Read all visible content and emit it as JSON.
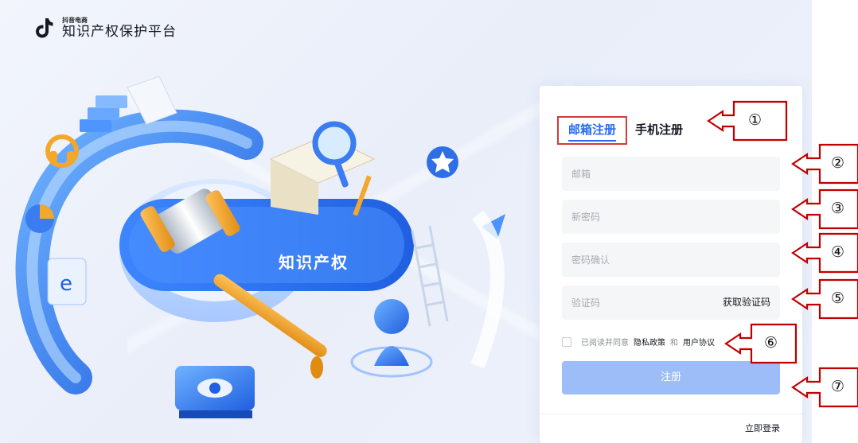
{
  "header": {
    "brand_small": "抖音电商",
    "brand_title": "知识产权保护平台"
  },
  "illustration": {
    "banner_text": "知识产权"
  },
  "form": {
    "tabs": [
      {
        "label": "邮箱注册",
        "active": true
      },
      {
        "label": "手机注册",
        "active": false
      }
    ],
    "email_placeholder": "邮箱",
    "new_password_placeholder": "新密码",
    "confirm_password_placeholder": "密码确认",
    "code_placeholder": "验证码",
    "get_code_label": "获取验证码",
    "agree_prefix": "已阅读并同意",
    "privacy_policy": "隐私政策",
    "and_text": "和",
    "user_agreement": "用户协议",
    "submit_label": "注册",
    "login_link": "立即登录"
  },
  "annotations": [
    "①",
    "②",
    "③",
    "④",
    "⑤",
    "⑥",
    "⑦"
  ],
  "colors": {
    "accent": "#2a6bf2",
    "submit_disabled": "#9dbdf8",
    "annotation_red": "#c00000"
  }
}
